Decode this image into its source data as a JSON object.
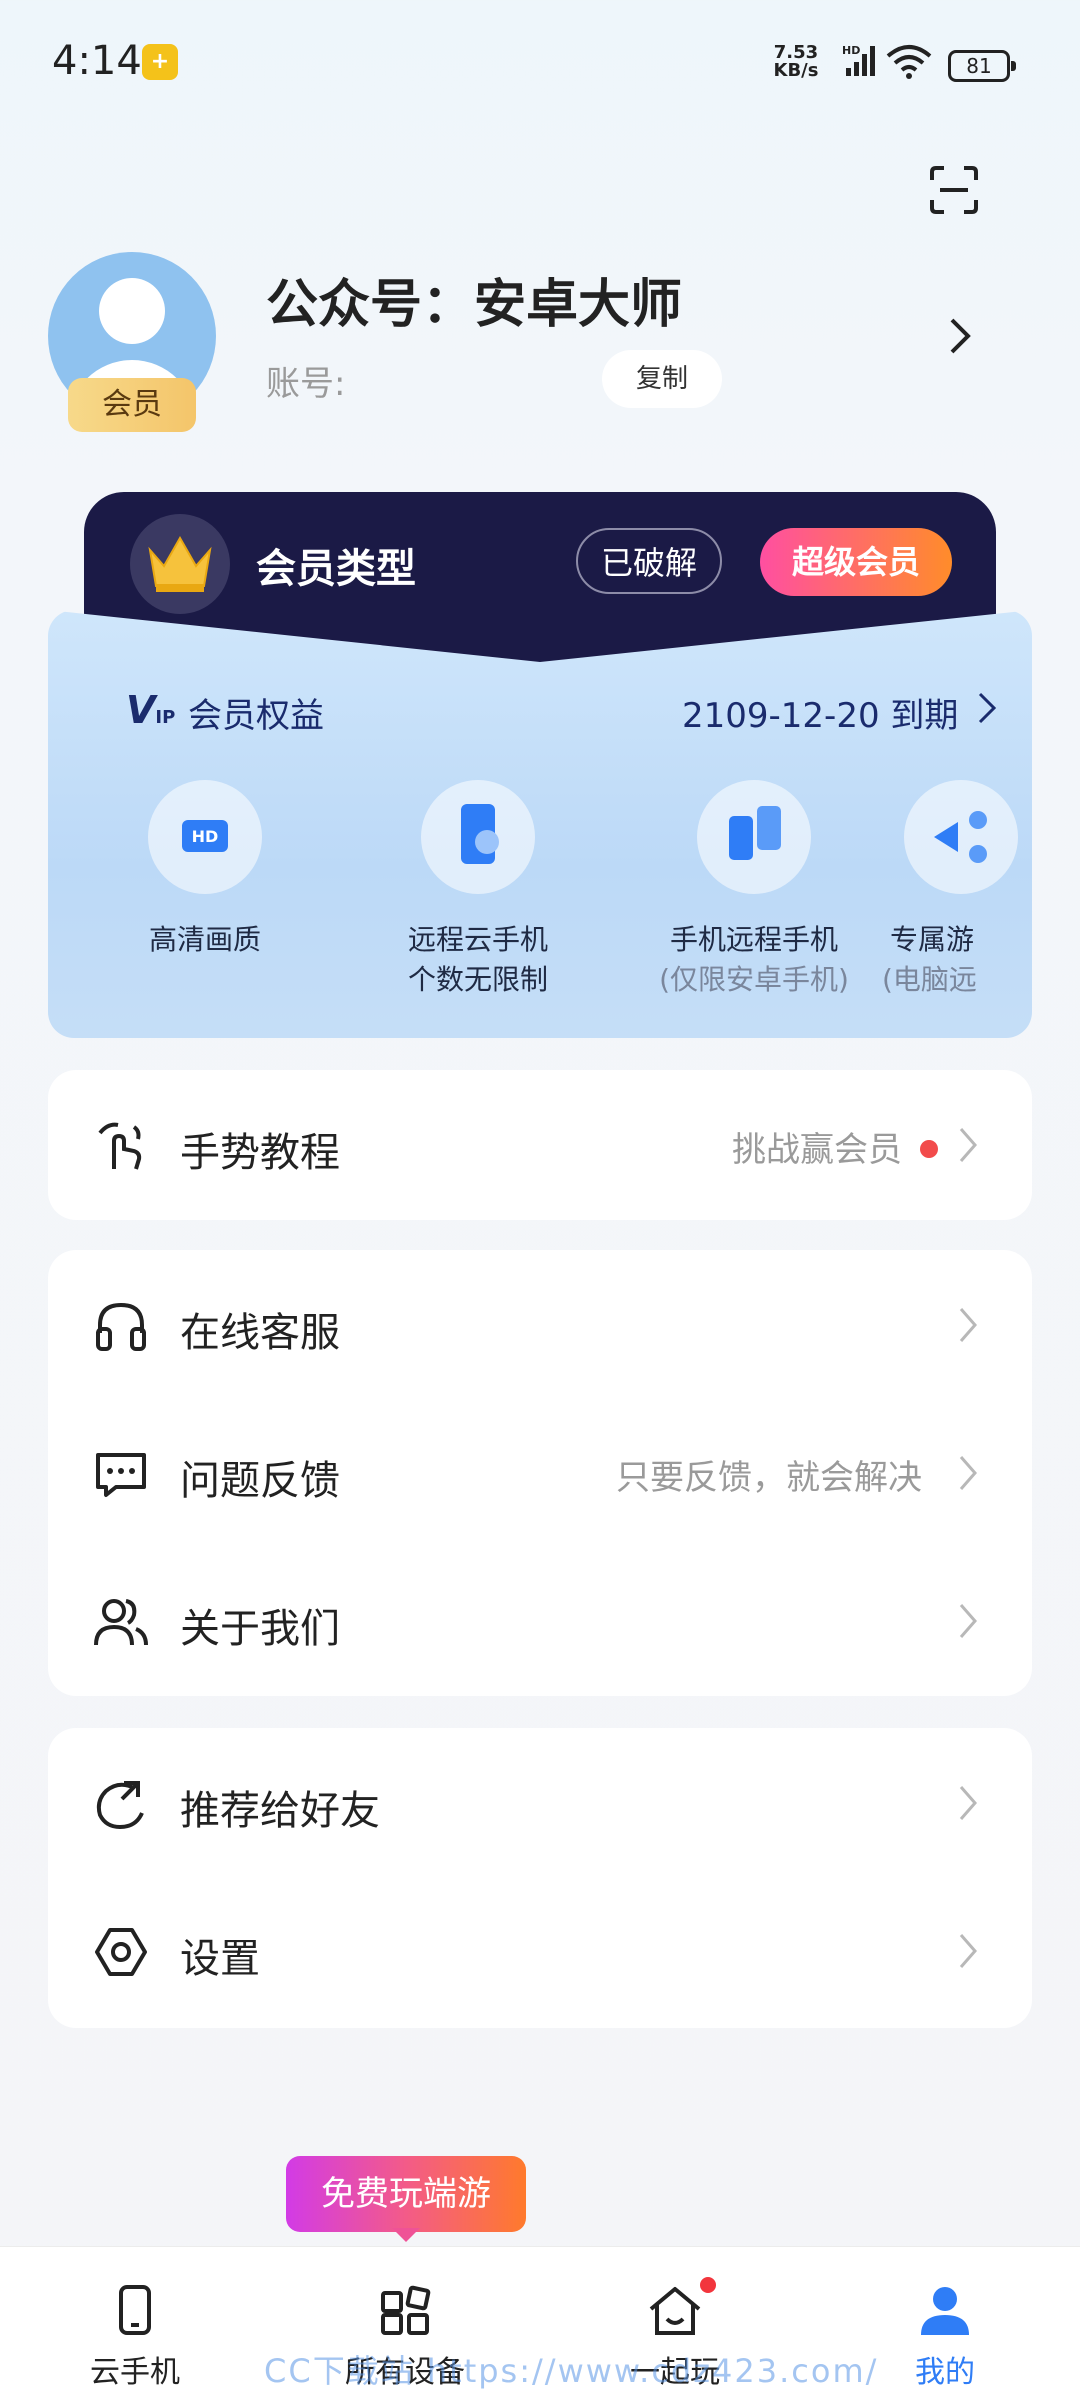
{
  "status": {
    "time": "4:14",
    "netspeed": "7.53",
    "netspeed_unit": "KB/s",
    "signal_label": "HD",
    "battery": "81"
  },
  "profile": {
    "name": "公众号：安卓大师",
    "account_label": "账号:",
    "copy_label": "复制",
    "member_tag": "会员"
  },
  "vip": {
    "type_label": "会员类型",
    "cracked_label": "已破解",
    "super_label": "超级会员",
    "logo": "V",
    "logo_small": "IP",
    "benefits_label": "会员权益",
    "expire": "2109-12-20 到期",
    "benefits": [
      {
        "title": "高清画质",
        "sub": "",
        "icon": "hd-icon"
      },
      {
        "title": "远程云手机",
        "sub2": "个数无限制",
        "icon": "cloud-phone-icon"
      },
      {
        "title": "手机远程手机",
        "sub": "(仅限安卓手机)",
        "icon": "phone-remote-icon"
      },
      {
        "title": "专属游",
        "sub": "(电脑远",
        "icon": "exclusive-icon"
      }
    ]
  },
  "menu": {
    "gesture": {
      "label": "手势教程",
      "hint": "挑战赢会员"
    },
    "service": {
      "label": "在线客服"
    },
    "feedback": {
      "label": "问题反馈",
      "hint": "只要反馈，就会解决"
    },
    "about": {
      "label": "关于我们"
    },
    "share": {
      "label": "推荐给好友"
    },
    "settings": {
      "label": "设置"
    }
  },
  "promo": "免费玩端游",
  "nav": [
    {
      "label": "云手机",
      "icon": "phone-icon"
    },
    {
      "label": "所有设备",
      "icon": "grid-icon"
    },
    {
      "label": "一起玩",
      "icon": "home-icon"
    },
    {
      "label": "我的",
      "icon": "person-icon"
    }
  ],
  "watermark": "CC下载站 https://www.cdz423.com/",
  "colors": {
    "accent": "#2f7df6",
    "vip_dark": "#1b1a46",
    "badge_red": "#f24b4b"
  }
}
